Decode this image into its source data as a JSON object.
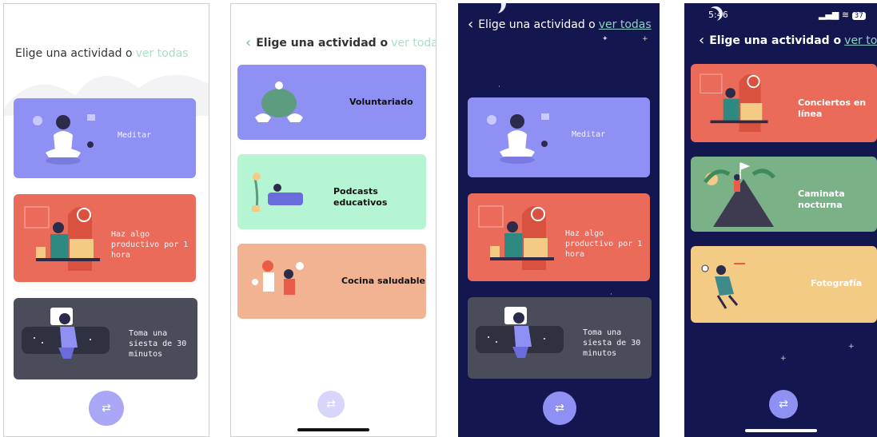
{
  "colors": {
    "purple": "#8f90f3",
    "coral": "#eb6b5a",
    "slate": "#4b4c5a",
    "mint": "#b6f5d4",
    "peach": "#f2b393",
    "green": "#7bb187",
    "yellow": "#f4cb84",
    "night": "#14174f",
    "fab_purple": "#a9a7f5"
  },
  "screens": [
    {
      "header": {
        "title": "Elige una actividad o",
        "link": "ver todas"
      },
      "cards": [
        {
          "label": "Meditar",
          "illustration": "meditation-illustration"
        },
        {
          "label": "Haz algo productivo por 1 hora",
          "illustration": "work-desk-illustration"
        },
        {
          "label": "Toma una siesta de 30 minutos",
          "illustration": "nap-illustration"
        }
      ],
      "fab_icon": "shuffle-icon"
    },
    {
      "header": {
        "title": "Elige una actividad o",
        "link": "ver todas"
      },
      "cards": [
        {
          "label": "Voluntariado",
          "illustration": "volunteer-illustration"
        },
        {
          "label": "Podcasts educativos",
          "illustration": "podcast-illustration"
        },
        {
          "label": "Cocina saludable",
          "illustration": "cooking-illustration"
        }
      ],
      "fab_icon": "shuffle-icon"
    },
    {
      "header": {
        "title": "Elige una actividad o",
        "link": "ver todas"
      },
      "cards": [
        {
          "label": "Meditar",
          "illustration": "meditation-illustration"
        },
        {
          "label": "Haz algo productivo por 1 hora",
          "illustration": "work-desk-illustration"
        },
        {
          "label": "Toma una siesta de 30 minutos",
          "illustration": "nap-illustration"
        }
      ],
      "fab_icon": "shuffle-icon"
    },
    {
      "status": {
        "time": "5:46",
        "battery": "37"
      },
      "header": {
        "title": "Elige una actividad o",
        "link": "ver todas"
      },
      "cards": [
        {
          "label": "Conciertos en línea",
          "illustration": "concert-illustration"
        },
        {
          "label": "Caminata nocturna",
          "illustration": "hiking-illustration"
        },
        {
          "label": "Fotografía",
          "illustration": "photography-illustration"
        }
      ],
      "fab_icon": "shuffle-icon"
    }
  ]
}
